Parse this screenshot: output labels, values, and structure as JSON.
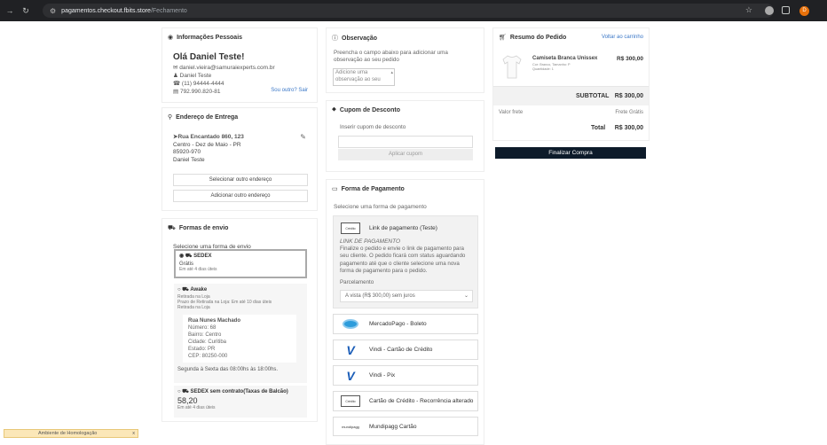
{
  "browser": {
    "url_domain": "pagamentos.checkout.fbits.store",
    "url_path": "/Fechamento",
    "profile_initial": "D"
  },
  "personal": {
    "header": "Informações Pessoais",
    "greeting": "Olá Daniel Teste!",
    "email": "daniel.vieira@samuraiexperts.com.br",
    "name": "Daniel Teste",
    "phone": "(11) 94444-4444",
    "document": "792.990.820-81",
    "logout": "Sou outro? Sair"
  },
  "address": {
    "header": "Endereço de Entrega",
    "street": "Rua Encantado 860, 123",
    "district": "Centro - Dez de Maio - PR",
    "zip": "85920-970",
    "recipient": "Daniel Teste",
    "select_other": "Selecionar outro endereço",
    "add_other": "Adicionar outro endereço"
  },
  "shipping": {
    "header": "Formas de envio",
    "subtitle": "Selecione uma forma de envio",
    "sedex_title": "SEDEX",
    "sedex_price": "Grátis",
    "sedex_eta": "Em até 4 dias úteis",
    "awake_title": "Awake",
    "awake_line1": "Retirada na Loja",
    "awake_line2": "Prazo de Retirada na Loja: Em até 10 dias úteis",
    "awake_line3": "Retirada na Loja",
    "store_name": "Rua Nunes Machado",
    "store_number": "Número: 68",
    "store_district": "Bairro: Centro",
    "store_city": "Cidade: Curitiba",
    "store_state": "Estado: PR",
    "store_zip": "CEP: 80250-000",
    "store_hours": "Segunda à Sexta das 08:00hs às 18:00hs.",
    "sedex2_title": "SEDEX sem contrato(Taxas de Balcão)",
    "sedex2_price": "58,20",
    "sedex2_eta": "Em até 4 dias úteis"
  },
  "observation": {
    "header": "Observação",
    "desc": "Preencha o campo abaixo para adicionar uma observação ao seu pedido",
    "placeholder": "Adicione uma observação ao seu"
  },
  "coupon": {
    "header": "Cupom de Desconto",
    "label": "Inserir cupom de desconto",
    "button": "Aplicar cupom"
  },
  "payment": {
    "header": "Forma de Pagamento",
    "subtitle": "Selecione uma forma de pagamento",
    "link_label": "Link de pagamento (Teste)",
    "link_title": "LINK DE PAGAMENTO",
    "link_desc": "Finalize o pedido e envie o link de pagamento para seu cliente. O pedido ficará com status aguardando pagamento até que o cliente selecione uma nova forma de pagamento para o pedido.",
    "installments_label": "Parcelamento",
    "installments_value": "A vista (R$ 300,00) sem juros",
    "method_mp": "MercadoPago - Boleto",
    "method_vindi_card": "Vindi - Cartão de Crédito",
    "method_vindi_pix": "Vindi - Pix",
    "method_recurrence": "Cartão de Crédito - Recorrência alterado",
    "method_mundipagg": "Mundipagg Cartão",
    "mundipagg_logo": "mundipagg",
    "card_logo_text": "Crédito"
  },
  "summary": {
    "header": "Resumo do Pedido",
    "back": "Voltar ao carrinho",
    "product_name": "Camiseta Branca Unissex",
    "product_variant": "Cor: Branco, Tamanho: P",
    "product_qty": "Quantidade: 1",
    "product_price": "R$ 300,00",
    "subtotal_label": "SUBTOTAL",
    "subtotal_value": "R$ 300,00",
    "freight_label": "Valor frete",
    "freight_value": "Frete Grátis",
    "total_label": "Total",
    "total_value": "R$ 300,00",
    "finish": "Finalizar Compra"
  },
  "footer": {
    "env": "Ambiente de Homologação",
    "close": "x"
  }
}
